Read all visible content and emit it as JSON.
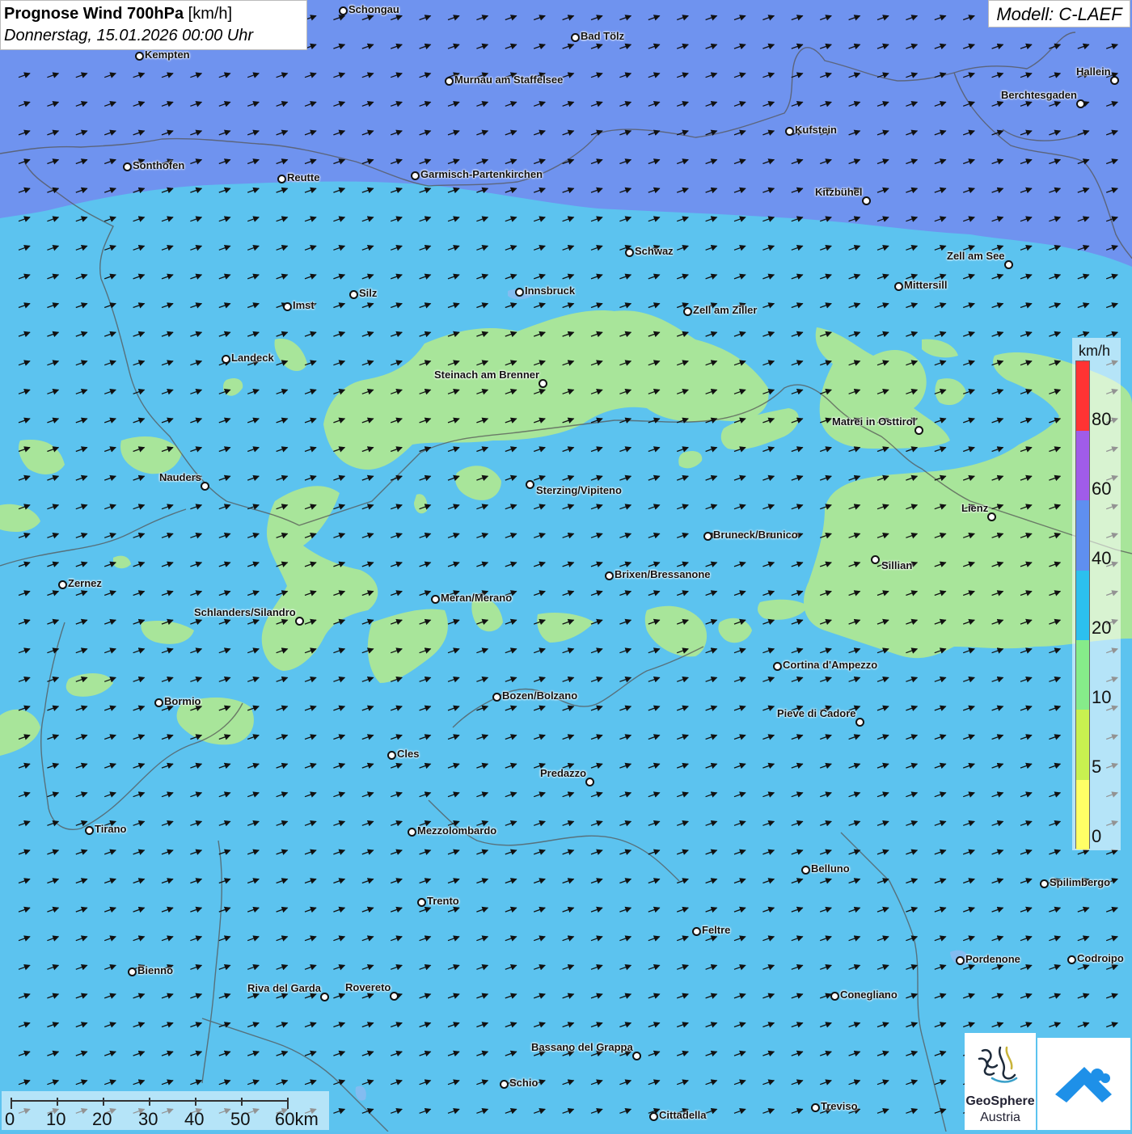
{
  "header": {
    "title_bold": "Prognose Wind 700hPa",
    "title_unit": "[km/h]",
    "subtitle": "Donnerstag, 15.01.2026 00:00 Uhr"
  },
  "model_label": "Modell: C-LAEF",
  "legend": {
    "unit": "km/h",
    "ticks": [
      "80",
      "60",
      "40",
      "20",
      "10",
      "5",
      "0"
    ],
    "colors_top_to_bottom": [
      "#ff3333",
      "#a05ce8",
      "#5f8ff0",
      "#2cc0ee",
      "#86ec8a",
      "#c8f050",
      "#ffff66"
    ]
  },
  "scale_bar": {
    "labels": [
      "0",
      "10",
      "20",
      "30",
      "40",
      "50",
      "60km"
    ]
  },
  "colors": {
    "band_20_40": "#5cc3ef",
    "band_40_60": "#6f93ef",
    "band_10_20": "#a8e59a"
  },
  "cities": [
    {
      "name": "Schongau"
    },
    {
      "name": "Bad Tölz"
    },
    {
      "name": "Kempten"
    },
    {
      "name": "Murnau am Staffelsee"
    },
    {
      "name": "Hallein"
    },
    {
      "name": "Berchtesgaden"
    },
    {
      "name": "Kufstein"
    },
    {
      "name": "Sonthofen"
    },
    {
      "name": "Reutte"
    },
    {
      "name": "Garmisch-Partenkirchen"
    },
    {
      "name": "Kitzbühel"
    },
    {
      "name": "Schwaz"
    },
    {
      "name": "Zell am See"
    },
    {
      "name": "Mittersill"
    },
    {
      "name": "Innsbruck"
    },
    {
      "name": "Silz"
    },
    {
      "name": "Imst"
    },
    {
      "name": "Zell am Ziller"
    },
    {
      "name": "Landeck"
    },
    {
      "name": "Steinach am Brenner"
    },
    {
      "name": "Matrei in Osttirol"
    },
    {
      "name": "Nauders"
    },
    {
      "name": "Sterzing/Vipiteno"
    },
    {
      "name": "Lienz"
    },
    {
      "name": "Bruneck/Brunico"
    },
    {
      "name": "Sillian"
    },
    {
      "name": "Brixen/Bressanone"
    },
    {
      "name": "Zernez"
    },
    {
      "name": "Meran/Merano"
    },
    {
      "name": "Schlanders/Silandro"
    },
    {
      "name": "Cortina d'Ampezzo"
    },
    {
      "name": "Bozen/Bolzano"
    },
    {
      "name": "Bormio"
    },
    {
      "name": "Pieve di Cadore"
    },
    {
      "name": "Cles"
    },
    {
      "name": "Predazzo"
    },
    {
      "name": "Tirano"
    },
    {
      "name": "Mezzolombardo"
    },
    {
      "name": "Belluno"
    },
    {
      "name": "Spilimbergo"
    },
    {
      "name": "Trento"
    },
    {
      "name": "Feltre"
    },
    {
      "name": "Bienno"
    },
    {
      "name": "Pordenone"
    },
    {
      "name": "Codroipo"
    },
    {
      "name": "Riva del Garda"
    },
    {
      "name": "Rovereto"
    },
    {
      "name": "Conegliano"
    },
    {
      "name": "Bassano del Grappa"
    },
    {
      "name": "Schio"
    },
    {
      "name": "Treviso"
    },
    {
      "name": "Cittadella"
    }
  ],
  "logo": {
    "name_line1": "GeoSphere",
    "name_line2": "Austria"
  }
}
